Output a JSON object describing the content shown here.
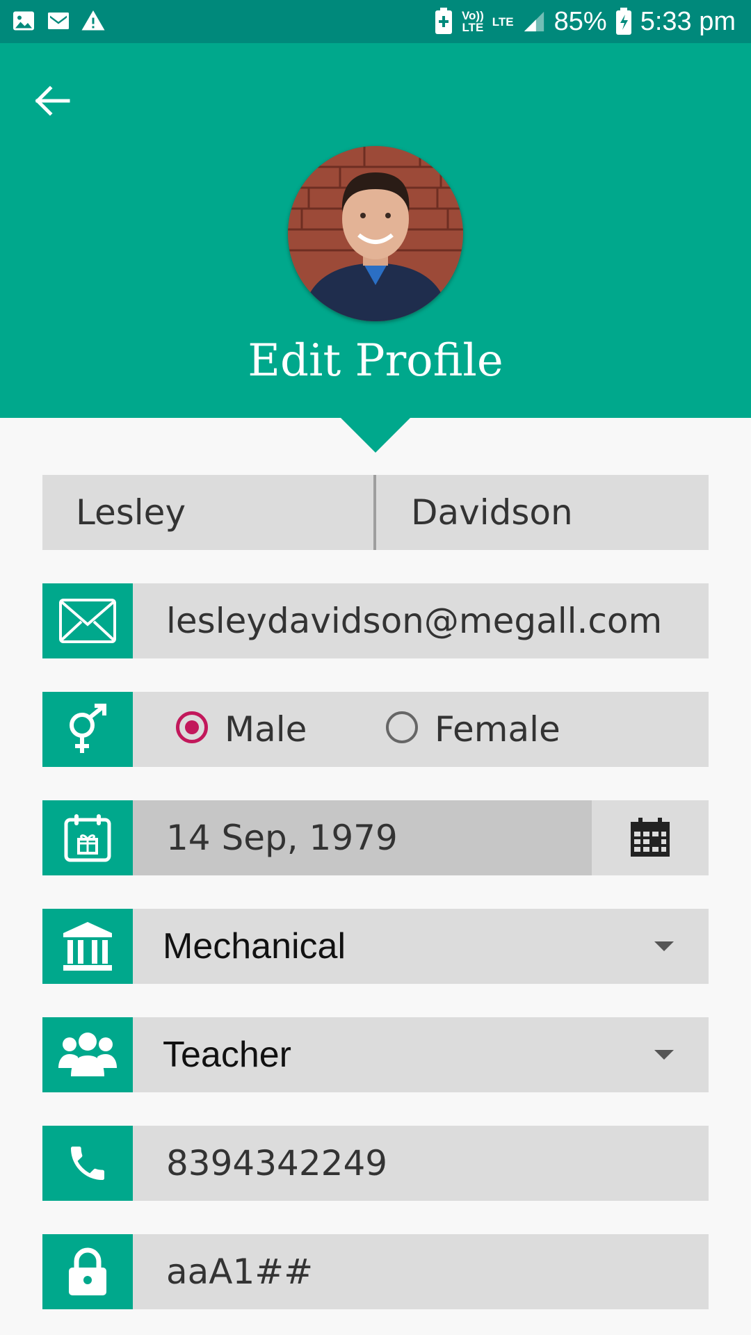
{
  "status_bar": {
    "volte_top": "Vo))",
    "volte_bottom": "LTE",
    "lte": "LTE",
    "battery": "85%",
    "time": "5:33 pm"
  },
  "header": {
    "title": "Edit Profile"
  },
  "form": {
    "first_name": "Lesley",
    "last_name": "Davidson",
    "email": "lesleydavidson@megall.com",
    "gender": {
      "selected": "Male",
      "options": [
        "Male",
        "Female"
      ]
    },
    "dob": "14 Sep, 1979",
    "department": "Mechanical",
    "role": "Teacher",
    "phone": "8394342249",
    "password": "aaA1##"
  },
  "colors": {
    "status_bar": "#00897b",
    "header": "#00a88c",
    "field_bg": "#dcdcdc",
    "radio_accent": "#c2185b"
  },
  "icons": {
    "status_left": [
      "gallery-icon",
      "gmail-icon",
      "warning-icon"
    ],
    "status_right": [
      "battery-saver-icon",
      "signal-icon",
      "battery-icon"
    ],
    "header": [
      "back-arrow-icon"
    ],
    "fields": [
      "email-icon",
      "gender-icon",
      "birthday-calendar-icon",
      "calendar-icon",
      "institution-icon",
      "group-icon",
      "phone-icon",
      "lock-icon"
    ]
  }
}
